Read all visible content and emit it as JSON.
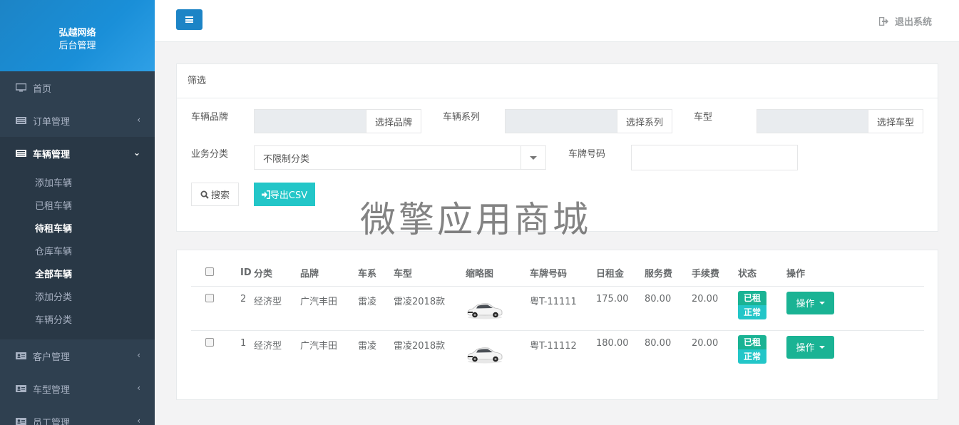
{
  "brand": {
    "line1": "弘越网络",
    "line2": "后台管理"
  },
  "sidebar": {
    "items": [
      {
        "label": "首页",
        "icon": "monitor-icon"
      },
      {
        "label": "订单管理",
        "icon": "list-icon",
        "arrow": "‹"
      },
      {
        "label": "车辆管理",
        "icon": "list-icon",
        "arrow": "⌄"
      },
      {
        "label": "客户管理",
        "icon": "id-card-icon",
        "arrow": "‹"
      },
      {
        "label": "车型管理",
        "icon": "id-card-icon",
        "arrow": "‹"
      },
      {
        "label": "员工管理",
        "icon": "id-card-icon",
        "arrow": "‹"
      }
    ],
    "vehicle_submenu": [
      "添加车辆",
      "已租车辆",
      "待租车辆",
      "仓库车辆",
      "全部车辆",
      "添加分类",
      "车辆分类"
    ]
  },
  "topbar": {
    "logout_label": "退出系统"
  },
  "filter": {
    "title": "筛选",
    "brand_label": "车辆品牌",
    "brand_button": "选择品牌",
    "series_label": "车辆系列",
    "series_button": "选择系列",
    "model_label": "车型",
    "model_button": "选择车型",
    "category_label": "业务分类",
    "category_value": "不限制分类",
    "plate_label": "车牌号码",
    "search_button": "搜索",
    "export_button": "导出CSV"
  },
  "watermark": "微擎应用商城",
  "table": {
    "headers": [
      "ID",
      "分类",
      "品牌",
      "车系",
      "车型",
      "缩略图",
      "车牌号码",
      "日租金",
      "服务费",
      "手续费",
      "状态",
      "操作"
    ],
    "rows": [
      {
        "id": "2",
        "category": "经济型",
        "brand": "广汽丰田",
        "series": "雷凌",
        "model": "雷凌2018款",
        "plate": "粤T-11111",
        "daily_rent": "175.00",
        "service_fee": "80.00",
        "handling_fee": "20.00",
        "status1": "已租",
        "status2": "正常",
        "action": "操作"
      },
      {
        "id": "1",
        "category": "经济型",
        "brand": "广汽丰田",
        "series": "雷凌",
        "model": "雷凌2018款",
        "plate": "粤T-11112",
        "daily_rent": "180.00",
        "service_fee": "80.00",
        "handling_fee": "20.00",
        "status1": "已租",
        "status2": "正常",
        "action": "操作"
      }
    ]
  }
}
